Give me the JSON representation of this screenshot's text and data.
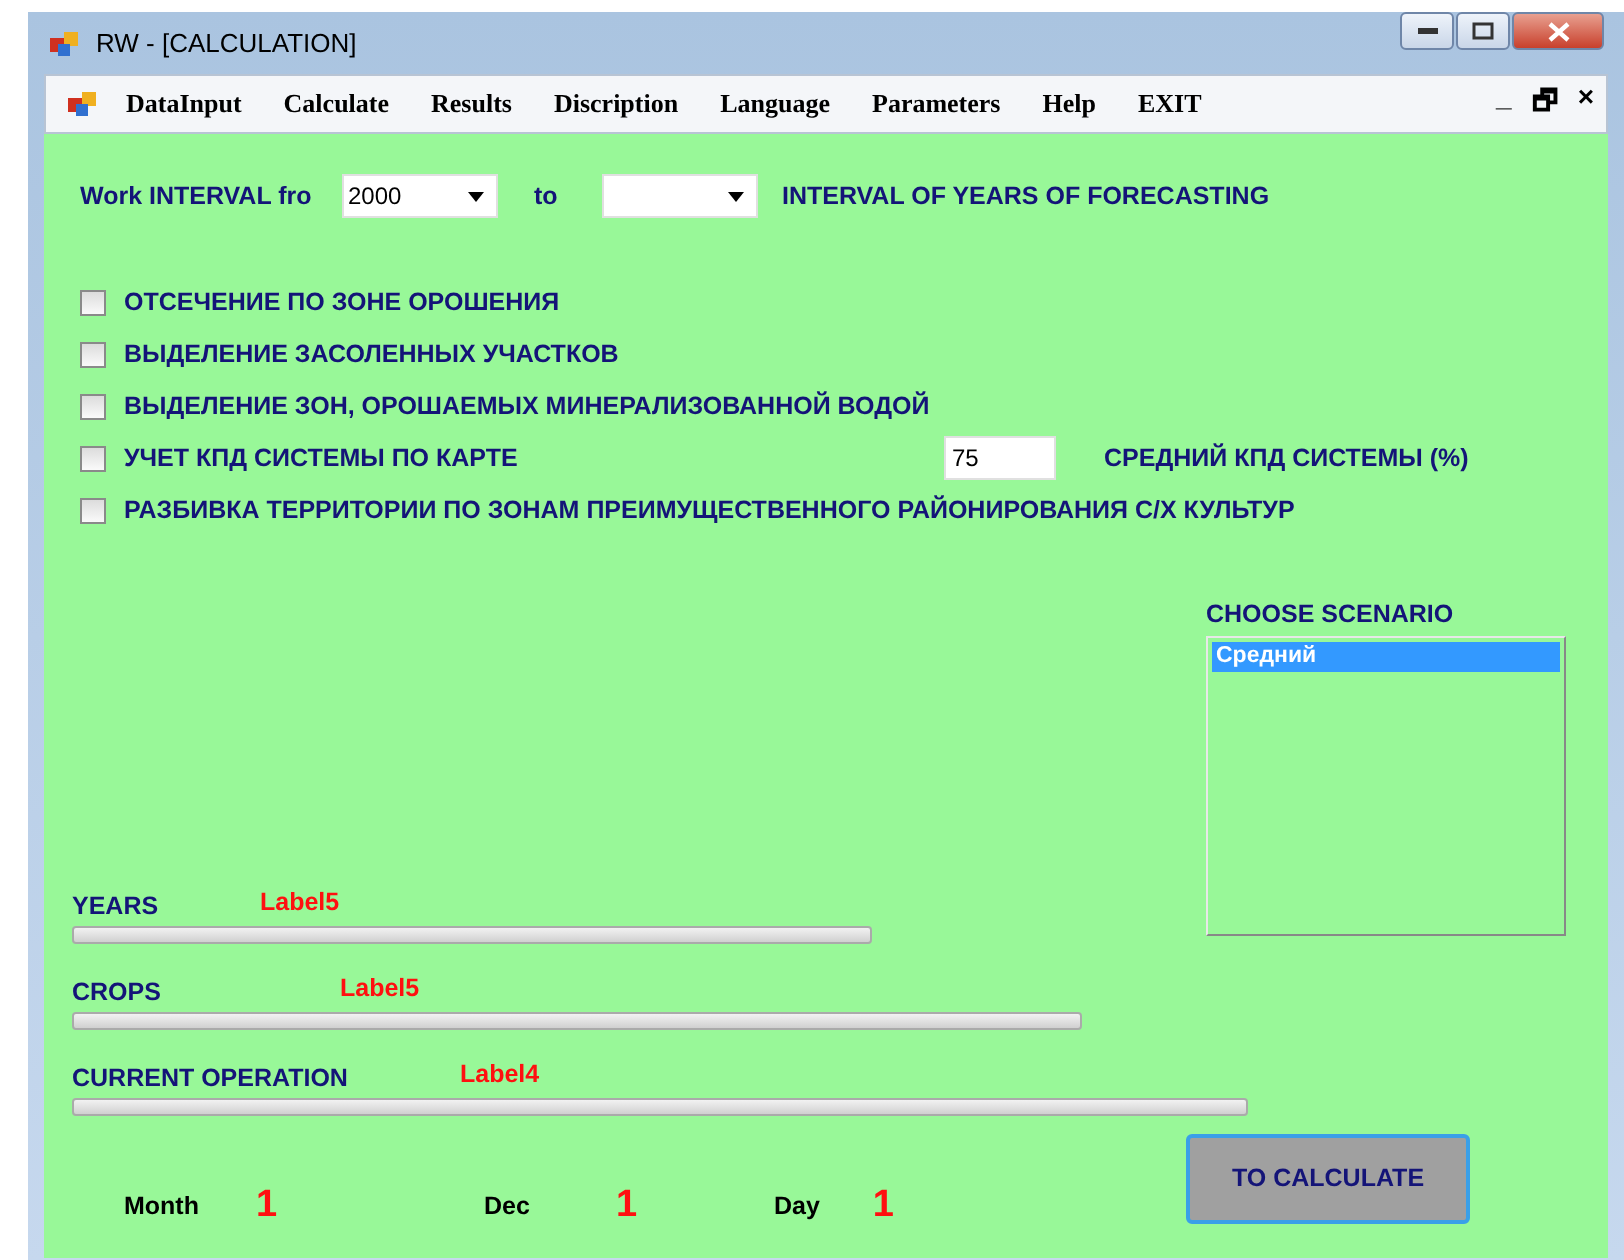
{
  "window": {
    "title": "RW - [CALCULATION]"
  },
  "menu": {
    "items": [
      "DataInput",
      "Calculate",
      "Results",
      "Discription",
      "Language",
      "Parameters",
      "Help",
      "EXIT"
    ],
    "mdi_controls": [
      "_",
      "🗗",
      "×"
    ]
  },
  "interval": {
    "label": "Work INTERVAL fro",
    "from": "2000",
    "to_label": "to",
    "caption": "INTERVAL OF YEARS OF FORECASTING"
  },
  "options": [
    {
      "label": "ОТСЕЧЕНИЕ ПО ЗОНЕ ОРОШЕНИЯ",
      "checked": false
    },
    {
      "label": "ВЫДЕЛЕНИЕ ЗАСОЛЕННЫХ УЧАСТКОВ",
      "checked": false
    },
    {
      "label": "ВЫДЕЛЕНИЕ ЗОН, ОРОШАЕМЫХ МИНЕРАЛИЗОВАННОЙ ВОДОЙ",
      "checked": false
    },
    {
      "label": "УЧЕТ КПД СИСТЕМЫ ПО КАРТЕ",
      "checked": false,
      "efficiency_value": "75",
      "efficiency_label": "СРЕДНИЙ КПД СИСТЕМЫ (%)"
    },
    {
      "label": "РАЗБИВКА ТЕРРИТОРИИ ПО ЗОНАМ ПРЕИМУЩЕСТВЕННОГО РАЙОНИРОВАНИЯ  С/Х КУЛЬТУР",
      "checked": false
    }
  ],
  "scenario": {
    "title": "CHOOSE SCENARIO",
    "items": [
      {
        "label": "Средний",
        "selected": true
      }
    ]
  },
  "progress": [
    {
      "label": "YEARS",
      "status": "Label5",
      "level": 0
    },
    {
      "label": "CROPS",
      "status": "Label5",
      "level": 0
    },
    {
      "label": "CURRENT OPERATION",
      "status": "Label4",
      "level": 0
    }
  ],
  "counters": [
    {
      "label": "Month",
      "value": "1"
    },
    {
      "label": "Dec",
      "value": "1"
    },
    {
      "label": "Day",
      "value": "1"
    }
  ],
  "calculate_button": "TO CALCULATE"
}
